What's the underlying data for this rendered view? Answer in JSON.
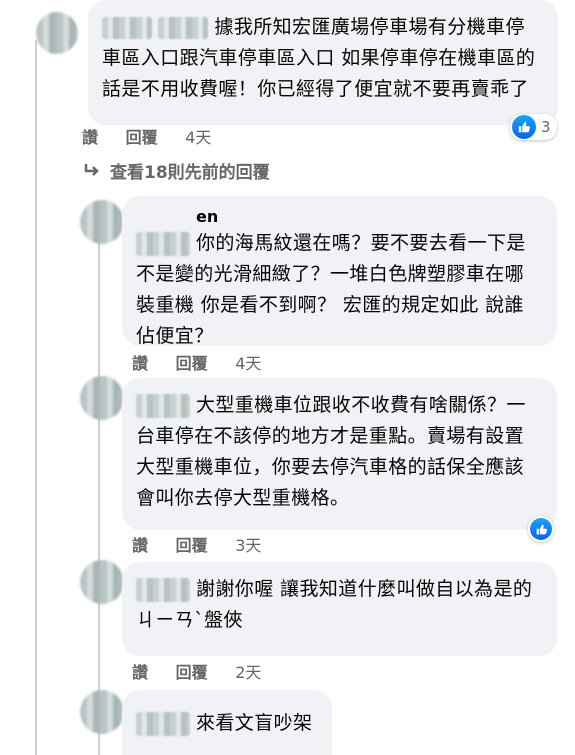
{
  "comments": [
    {
      "name": "",
      "text": "據我所知宏匯廣場停車場有分機車停車區入口跟汽車停車區入口 如果停車停在機車區的話是不用收費喔！你已經得了便宜就不要再賣乖了",
      "actions": {
        "like": "讚",
        "reply": "回覆",
        "time": "4天"
      },
      "reaction_count": "3"
    },
    {
      "name": "en",
      "text": "你的海馬紋還在嗎？要不要去看一下是不是變的光滑細緻了？一堆白色牌塑膠車在哪裝重機 你是看不到啊？ 宏匯的規定如此 說誰佔便宜？",
      "actions": {
        "like": "讚",
        "reply": "回覆",
        "time": "4天"
      }
    },
    {
      "name": "",
      "text": "大型重機車位跟收不收費有啥關係？一台車停在不該停的地方才是重點。賣場有設置大型重機車位，你要去停汽車格的話保全應該會叫你去停大型重機格。",
      "actions": {
        "like": "讚",
        "reply": "回覆",
        "time": "3天"
      }
    },
    {
      "name": "",
      "text": "謝謝你喔 讓我知道什麼叫做自以為是的ㄐㄧㄢˋ盤俠",
      "actions": {
        "like": "讚",
        "reply": "回覆",
        "time": "2天"
      }
    },
    {
      "name": "",
      "text": "來看文盲吵架"
    }
  ],
  "view_previous": "查看18則先前的回覆",
  "icons": {
    "reply_arrow": "reply-arrow-icon",
    "like": "like-icon"
  },
  "colors": {
    "bubble": "#f0f2f5",
    "like_blue": "#0866ff",
    "meta": "#65676b"
  }
}
